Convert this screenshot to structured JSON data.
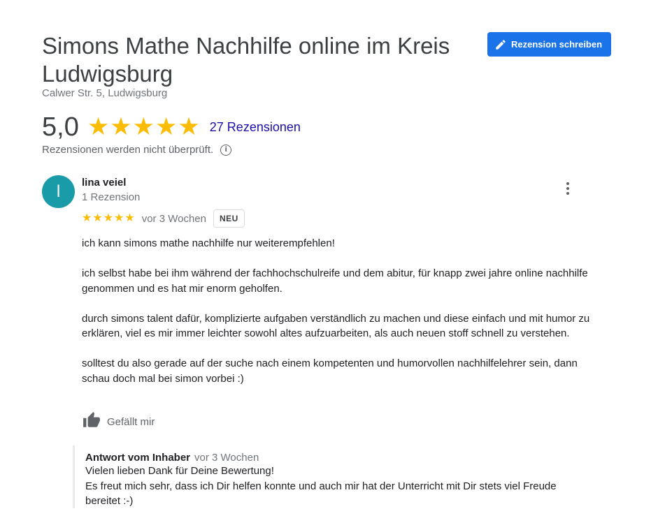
{
  "place": {
    "title": "Simons Mathe Nachhilfe online im Kreis Ludwigsburg",
    "address": "Calwer Str. 5, Ludwigsburg"
  },
  "actions": {
    "write_review_label": "Rezension schreiben",
    "write_review_icon": "pencil-icon"
  },
  "summary": {
    "rating": "5,0",
    "stars": 5,
    "review_count_label": "27 Rezensionen",
    "not_verified_note": "Rezensionen werden nicht überprüft.",
    "info_icon": "i"
  },
  "review": {
    "avatar_letter": "l",
    "reviewer_name": "lina veiel",
    "reviewer_review_count": "1 Rezension",
    "stars": 5,
    "time": "vor 3 Wochen",
    "badge": "NEU",
    "paragraphs": [
      "ich kann simons mathe nachhilfe nur weiterempfehlen!",
      "ich selbst habe bei ihm während der fachhochschulreife und dem abitur, für knapp zwei jahre online nachhilfe genommen und es hat mir enorm geholfen.",
      "durch simons talent dafür, komplizierte aufgaben verständlich zu machen und diese einfach und mit humor zu erklären, viel es mir immer leichter sowohl altes aufzuarbeiten, als auch neuen stoff schnell zu verstehen.",
      "solltest du also gerade auf der suche nach einem kompetenten und humorvollen nachhilfelehrer sein, dann schau doch mal bei simon vorbei :)"
    ],
    "like_label": "Gefällt mir"
  },
  "owner_reply": {
    "label": "Antwort vom Inhaber",
    "time": "vor 3 Wochen",
    "lines": [
      "Vielen lieben Dank für Deine Bewertung!",
      "Es freut mich sehr, dass ich Dir helfen konnte und auch mir hat der Unterricht mit Dir stets viel Freude bereitet :-)"
    ]
  },
  "colors": {
    "accent": "#1a73e8",
    "star": "#fbbc04",
    "avatar": "#1a9ba8",
    "link": "#1a0dab"
  }
}
